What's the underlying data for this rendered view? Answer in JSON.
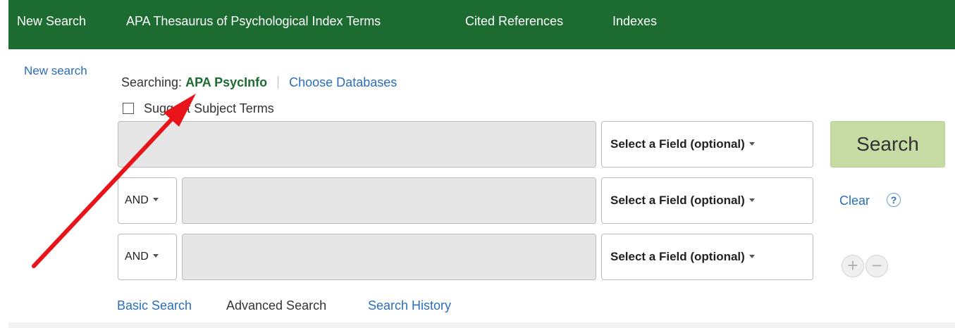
{
  "topnav": {
    "items": [
      {
        "label": "New Search"
      },
      {
        "label": "APA Thesaurus of Psychological Index Terms"
      },
      {
        "label": "Cited References"
      },
      {
        "label": "Indexes"
      }
    ]
  },
  "sidebar": {
    "new_search": "New search"
  },
  "searching": {
    "label": "Searching:",
    "database": "APA PsycInfo",
    "choose": "Choose Databases"
  },
  "suggest": {
    "label": "Suggest Subject Terms",
    "checked": false
  },
  "rows": [
    {
      "operator": "",
      "value": "",
      "field": "Select a Field (optional)"
    },
    {
      "operator": "AND",
      "value": "",
      "field": "Select a Field (optional)"
    },
    {
      "operator": "AND",
      "value": "",
      "field": "Select a Field (optional)"
    }
  ],
  "actions": {
    "search": "Search",
    "clear": "Clear",
    "help": "?",
    "add": "+",
    "remove": "−"
  },
  "modes": {
    "basic": "Basic Search",
    "advanced": "Advanced Search",
    "history": "Search History"
  },
  "colors": {
    "nav_bg": "#1c6b30",
    "link": "#2a6ebb",
    "search_btn": "#c7dba4",
    "arrow": "#e8141a"
  }
}
